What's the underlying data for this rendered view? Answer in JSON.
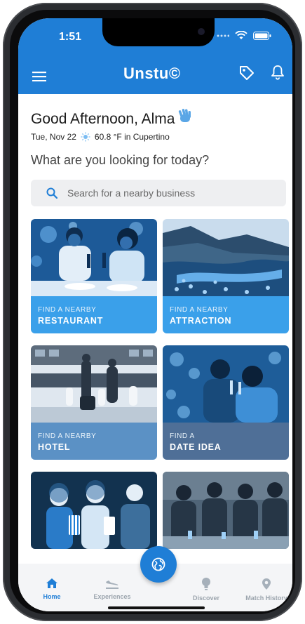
{
  "status_bar": {
    "time": "1:51"
  },
  "header": {
    "logo": "Unstu©"
  },
  "greeting": {
    "text": "Good Afternoon, Alma",
    "date": "Tue, Nov 22",
    "weather": "60.8 °F in Cupertino"
  },
  "question": "What are you looking for today?",
  "search": {
    "placeholder": "Search for a nearby business"
  },
  "cards": [
    {
      "sub": "FIND A NEARBY",
      "title": "RESTAURANT"
    },
    {
      "sub": "FIND A NEARBY",
      "title": "ATTRACTION"
    },
    {
      "sub": "FIND A NEARBY",
      "title": "HOTEL"
    },
    {
      "sub": "FIND A",
      "title": "DATE IDEA"
    }
  ],
  "nav": {
    "home": "Home",
    "experiences": "Experiences",
    "discover": "Discover",
    "match_history": "Match History"
  },
  "colors": {
    "brand": "#1f7ed6",
    "card_label": "#3aa0ea",
    "hotel_label": "#5b91c5",
    "date_label": "#4f6f97"
  }
}
